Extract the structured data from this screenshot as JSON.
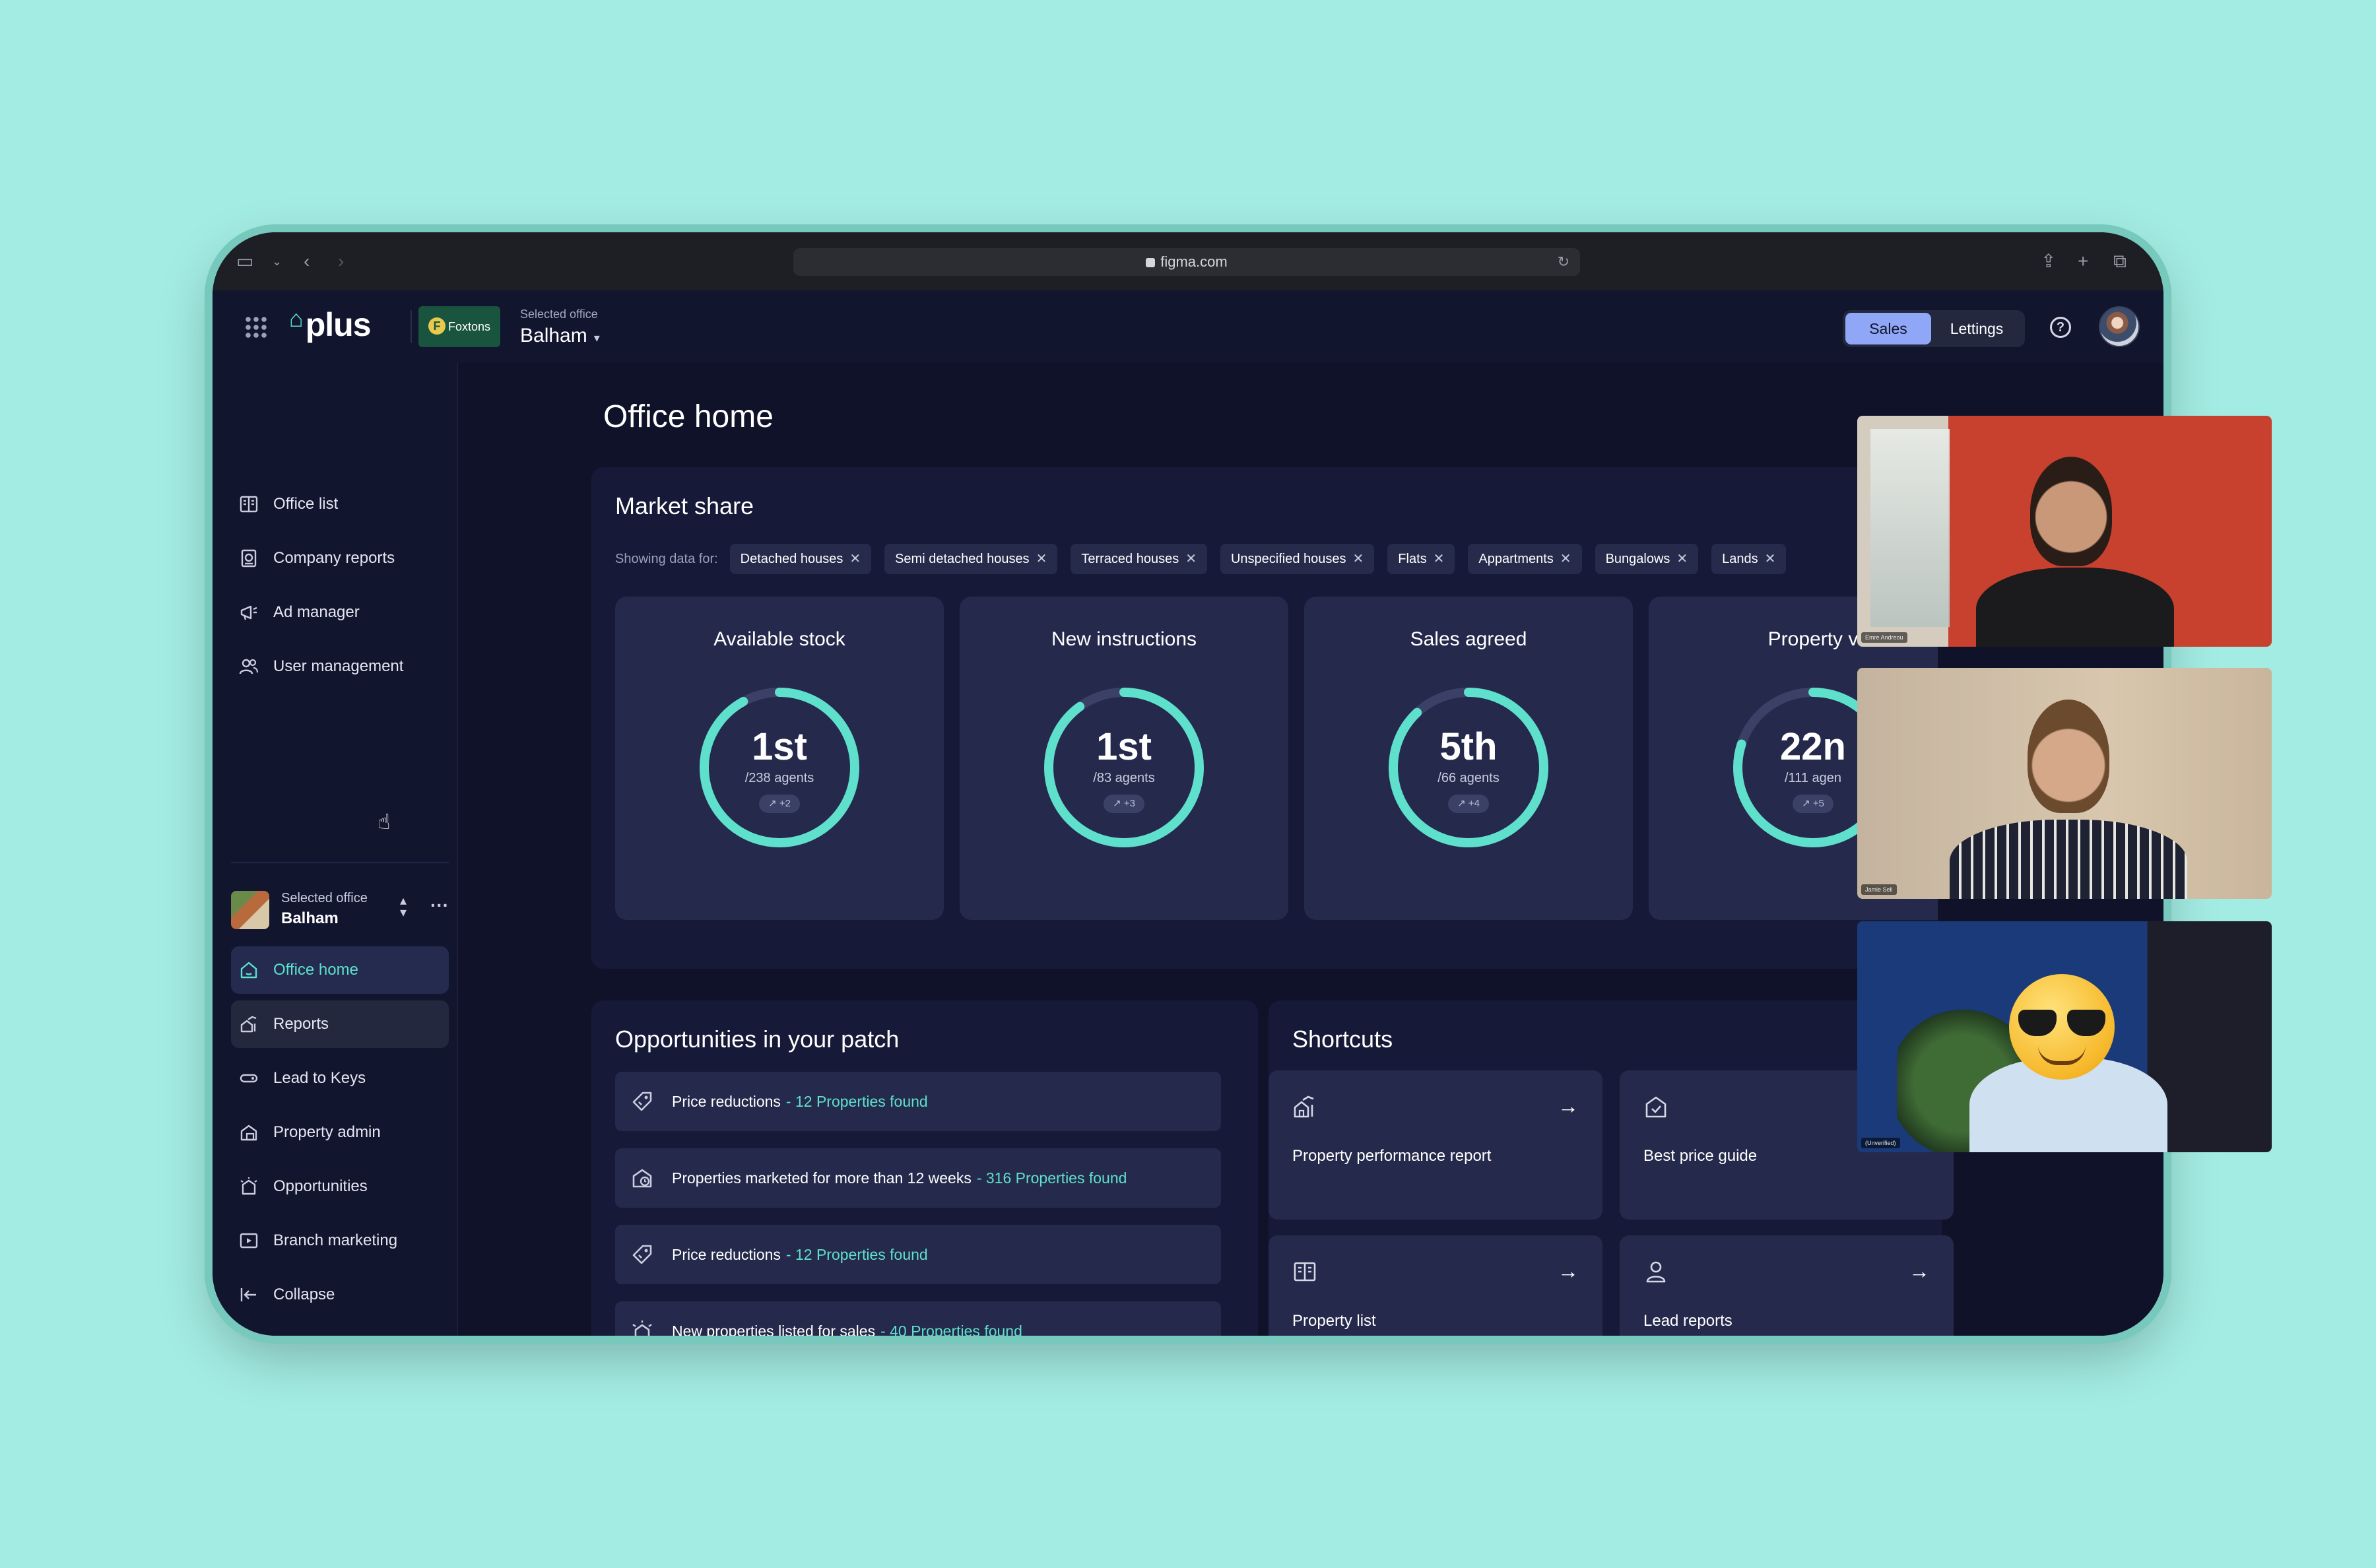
{
  "browser": {
    "url": "figma.com"
  },
  "header": {
    "logo": "plus",
    "brand": "Foxtons",
    "brand_initial": "F",
    "selected_office_label": "Selected office",
    "selected_office": "Balham",
    "segments": {
      "sales": "Sales",
      "lettings": "Lettings"
    }
  },
  "sidebar": {
    "top_items": [
      {
        "label": "Office list",
        "icon": "office-list-icon"
      },
      {
        "label": "Company reports",
        "icon": "company-reports-icon"
      },
      {
        "label": "Ad manager",
        "icon": "megaphone-icon"
      },
      {
        "label": "User management",
        "icon": "users-icon"
      }
    ],
    "office_selector": {
      "label": "Selected office",
      "value": "Balham"
    },
    "office_items": [
      {
        "label": "Office home",
        "icon": "home-icon",
        "state": "active"
      },
      {
        "label": "Reports",
        "icon": "reports-icon",
        "state": "hover"
      },
      {
        "label": "Lead to Keys",
        "icon": "keys-icon"
      },
      {
        "label": "Property admin",
        "icon": "property-admin-icon"
      },
      {
        "label": "Opportunities",
        "icon": "opportunities-icon"
      },
      {
        "label": "Branch marketing",
        "icon": "branch-marketing-icon"
      }
    ],
    "collapse_label": "Collapse"
  },
  "main": {
    "title": "Office home",
    "market_share": {
      "title": "Market share",
      "showing_label": "Showing data for:",
      "filters": [
        "Detached houses",
        "Semi detached houses",
        "Terraced houses",
        "Unspecified houses",
        "Flats",
        "Appartments",
        "Bungalows",
        "Lands"
      ],
      "stats": [
        {
          "title": "Available stock",
          "rank": "1st",
          "agents": "/238 agents",
          "delta": "+2",
          "fraction": 0.92
        },
        {
          "title": "New instructions",
          "rank": "1st",
          "agents": "/83 agents",
          "delta": "+3",
          "fraction": 0.9
        },
        {
          "title": "Sales agreed",
          "rank": "5th",
          "agents": "/66 agents",
          "delta": "+4",
          "fraction": 0.88
        },
        {
          "title": "Property v",
          "rank": "22n",
          "agents": "/111 agen",
          "delta": "+5",
          "fraction": 0.8
        }
      ]
    },
    "opportunities": {
      "title": "Opportunities in your patch",
      "rows": [
        {
          "text": "Price reductions",
          "count": "- 12 Properties found",
          "icon": "price-tag-icon"
        },
        {
          "text": "Properties marketed for more than 12 weeks",
          "count": "- 316 Properties found",
          "icon": "house-clock-icon"
        },
        {
          "text": "Price reductions",
          "count": "- 12 Properties found",
          "icon": "price-tag-icon"
        },
        {
          "text": "New properties listed for sales",
          "count": "- 40 Properties found",
          "icon": "new-listing-icon"
        }
      ]
    },
    "shortcuts": {
      "title": "Shortcuts",
      "tiles": [
        {
          "label": "Property performance report",
          "icon": "chart-house-icon"
        },
        {
          "label": "Best price guide",
          "icon": "price-guide-icon"
        },
        {
          "label": "Property list",
          "icon": "property-list-icon"
        },
        {
          "label": "Lead reports",
          "icon": "person-icon"
        }
      ]
    }
  },
  "video_call": {
    "tiles": [
      {
        "name": "Emre Andreou"
      },
      {
        "name": "Jamie Sell"
      },
      {
        "name": "(Unverified)"
      }
    ]
  },
  "colors": {
    "accent": "#5ee0cc",
    "bg": "#0f1229",
    "card": "#161a38",
    "tile": "#252a4c",
    "segment_on": "#90a6f7"
  }
}
